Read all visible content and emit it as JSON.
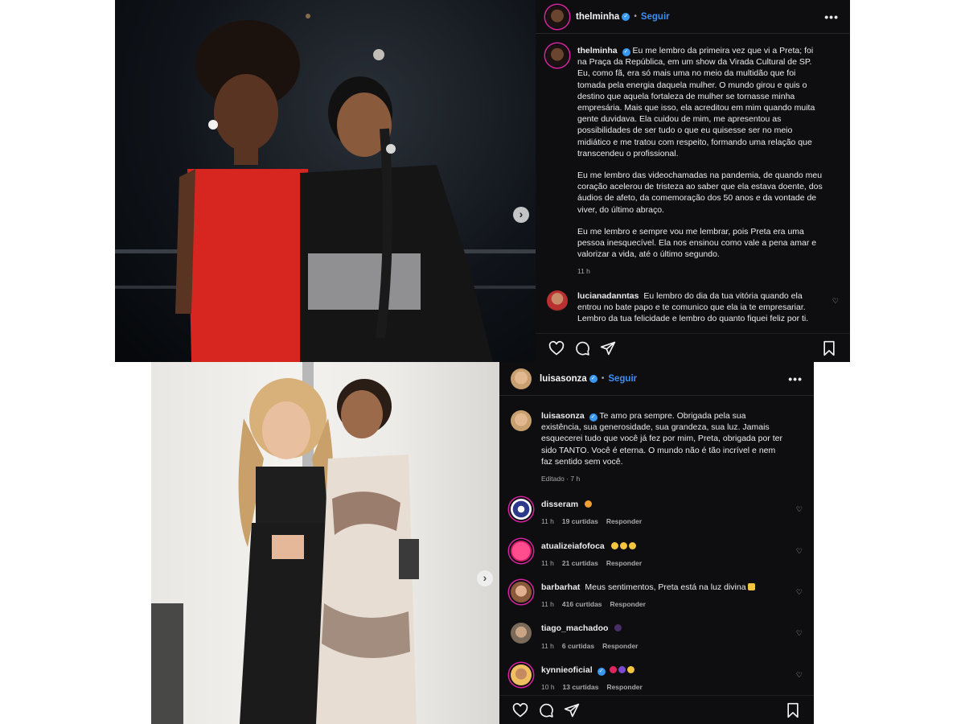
{
  "post1": {
    "header": {
      "username": "thelminha",
      "dot": "•",
      "follow_label": "Seguir",
      "more_label": "•••"
    },
    "caption": {
      "username": "thelminha",
      "paragraphs": [
        "Eu me lembro da primeira vez que vi a Preta; foi na Praça da República, em um show da Virada Cultural de SP. Eu, como fã, era só mais uma no meio da multidão que foi tomada pela energia daquela mulher. O mundo girou e quis o destino que aquela fortaleza de mulher se tornasse minha empresária. Mais que isso, ela acreditou em mim quando muita gente duvidava. Ela cuidou de mim, me apresentou as possibilidades de ser tudo o que eu quisesse ser no meio midiático e me tratou com respeito, formando uma relação que transcendeu o profissional.",
        "Eu me lembro das videochamadas na pandemia, de quando meu coração acelerou de tristeza ao saber que ela estava doente, dos áudios de afeto, da comemoração dos 50 anos e da vontade de viver, do último abraço.",
        "Eu me lembro e sempre vou me lembrar, pois Preta era uma pessoa inesquecível. Ela nos ensinou como vale a pena amar e valorizar a vida, até o último segundo."
      ],
      "time": "11 h"
    },
    "comment": {
      "username": "lucianadanntas",
      "text": "Eu lembro do dia da tua vitória quando ela entrou no bate papo e te comunico que ela ia te empresariar. Lembro da tua felicidade e lembro do quanto fiquei feliz por ti."
    },
    "icons": [
      "heart-icon",
      "comment-icon",
      "share-icon",
      "bookmark-icon"
    ],
    "accent": "#3a8ff5"
  },
  "post2": {
    "header": {
      "username": "luisasonza",
      "dot": "•",
      "follow_label": "Seguir",
      "more_label": "•••"
    },
    "caption": {
      "username": "luisasonza",
      "text": "Te amo pra sempre. Obrigada pela sua existência, sua generosidade, sua grandeza, sua luz. Jamais esquecerei tudo que você já fez por mim, Preta, obrigada por ter sido TANTO. Você é eterna. O mundo não é tão incrível e nem faz sentido sem você.",
      "time": "Editado · 7 h"
    },
    "comments": [
      {
        "username": "disseram",
        "text": "",
        "time": "11 h",
        "likes": "19 curtidas",
        "reply": "Responder"
      },
      {
        "username": "atualizeiafofoca",
        "text": "",
        "time": "11 h",
        "likes": "21 curtidas",
        "reply": "Responder"
      },
      {
        "username": "barbarhat",
        "text": "Meus sentimentos, Preta está na luz divina",
        "time": "11 h",
        "likes": "416 curtidas",
        "reply": "Responder"
      },
      {
        "username": "tiago_machadoo",
        "text": "",
        "time": "11 h",
        "likes": "6 curtidas",
        "reply": "Responder"
      },
      {
        "username": "kynnieoficial",
        "text": "",
        "time": "10 h",
        "likes": "13 curtidas",
        "reply": "Responder"
      }
    ],
    "icons": [
      "heart-icon",
      "comment-icon",
      "share-icon",
      "bookmark-icon"
    ]
  },
  "next_glyph": "›",
  "heart_glyph": "♡",
  "verified_glyph": "✓"
}
